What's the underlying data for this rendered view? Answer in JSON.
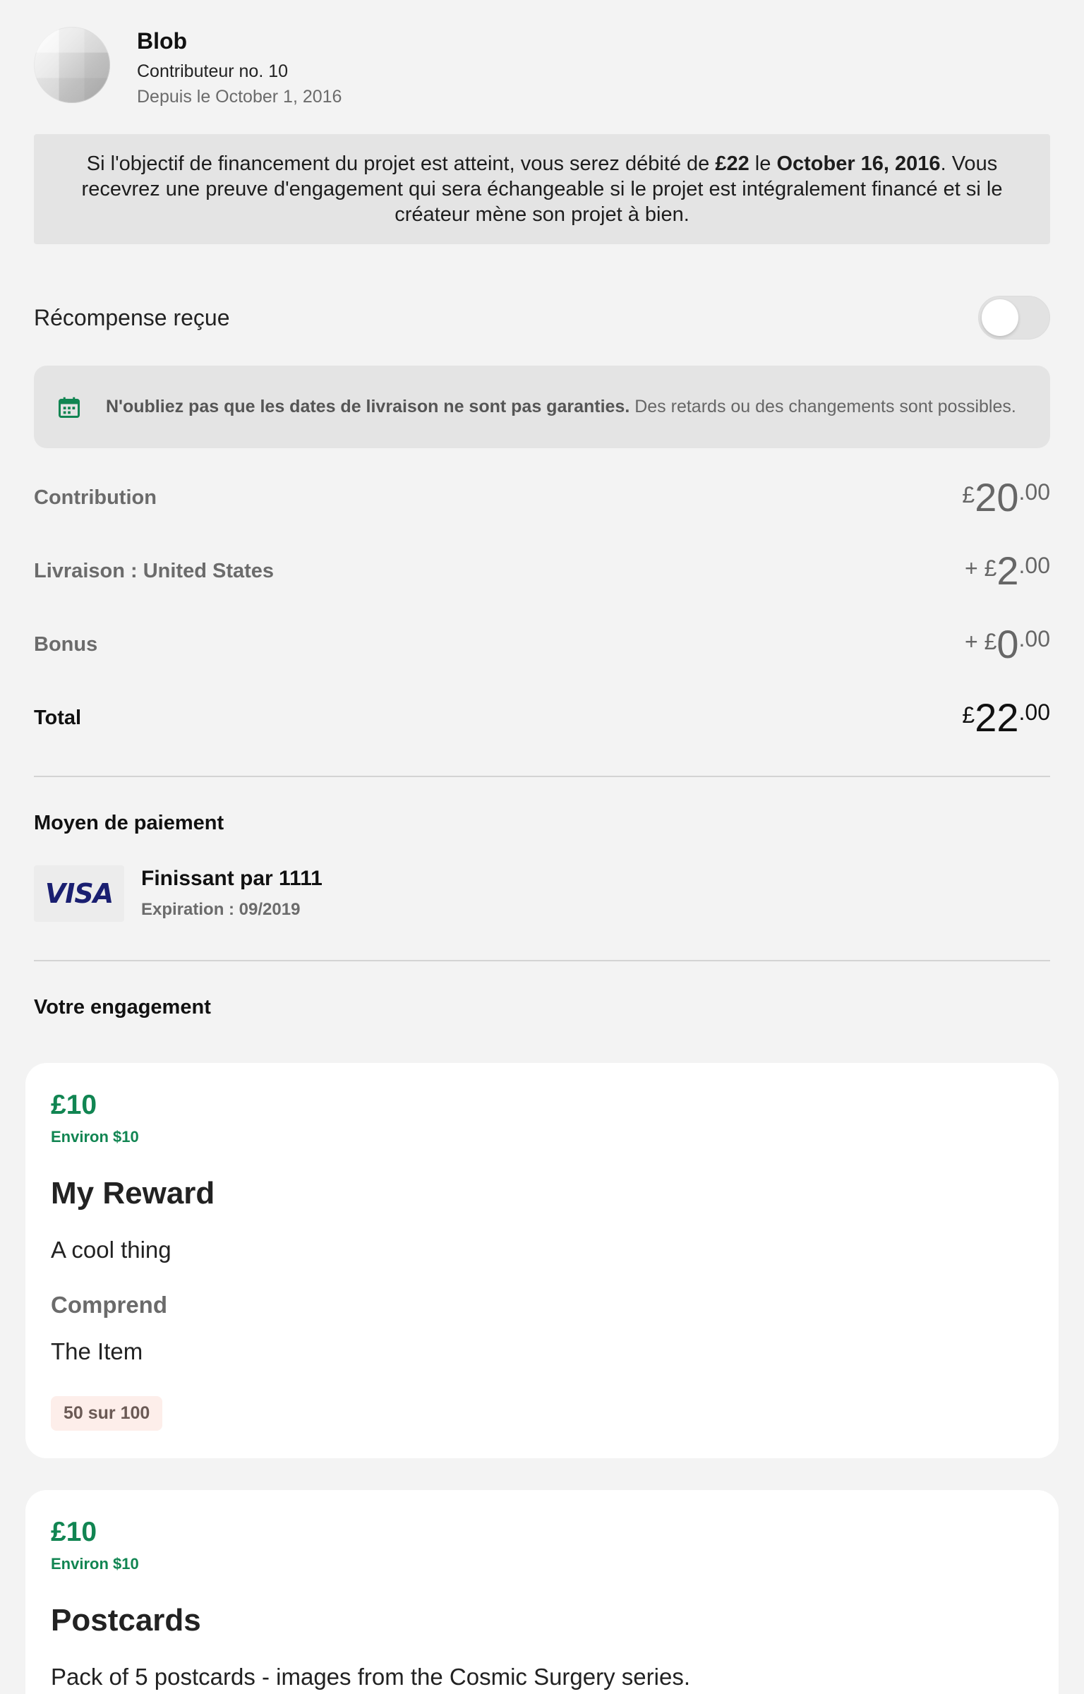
{
  "backer": {
    "name": "Blob",
    "number": "Contributeur no. 10",
    "since": "Depuis le October 1, 2016"
  },
  "banner": {
    "part1": "Si l'objectif de financement du projet est atteint, vous serez débité de ",
    "amount": "£22",
    "part2": " le ",
    "date": "October 16, 2016",
    "part3": ". Vous recevrez une preuve d'engagement qui sera échangeable si le projet est intégralement financé et si le créateur mène son projet à bien."
  },
  "reward_received": {
    "label": "Récompense reçue",
    "on": false
  },
  "delivery_notice": {
    "bold": "N'oubliez pas que les dates de livraison ne sont pas garanties.",
    "text": " Des retards ou des changements sont possibles.",
    "icon": "calendar-icon",
    "icon_color": "#118552"
  },
  "amounts": {
    "contribution": {
      "label": "Contribution",
      "prefix": "£",
      "whole": "20",
      "cents": ".00"
    },
    "shipping": {
      "label": "Livraison : United States",
      "prefix": "+ £",
      "whole": "2",
      "cents": ".00"
    },
    "bonus": {
      "label": "Bonus",
      "prefix": "+ £",
      "whole": "0",
      "cents": ".00"
    },
    "total": {
      "label": "Total",
      "prefix": "£",
      "whole": "22",
      "cents": ".00"
    }
  },
  "payment": {
    "title": "Moyen de paiement",
    "brand": "VISA",
    "ending": "Finissant par 1111",
    "expiration": "Expiration : 09/2019"
  },
  "pledge": {
    "title": "Votre engagement",
    "rewards": [
      {
        "price": "£10",
        "approx": "Environ $10",
        "title": "My Reward",
        "description": "A cool thing",
        "includes_label": "Comprend",
        "item": "The Item",
        "limit": "50 sur 100"
      },
      {
        "price": "£10",
        "approx": "Environ $10",
        "title": "Postcards",
        "description": "Pack of 5 postcards - images from the Cosmic Surgery series."
      }
    ]
  },
  "colors": {
    "accent_green": "#118552",
    "background": "#f3f3f3",
    "panel": "#e4e4e4"
  }
}
